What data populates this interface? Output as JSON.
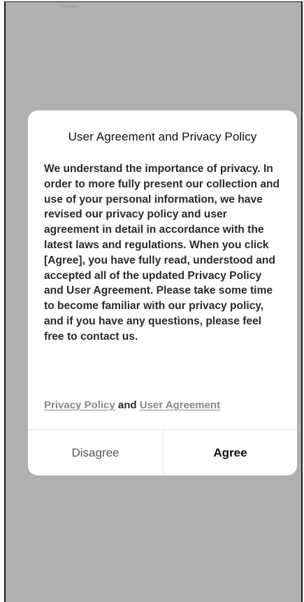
{
  "dialog": {
    "title": "User Agreement and Privacy Policy",
    "body": "We understand the importance of privacy. In order to more fully present our collection and use of your personal information, we have revised our privacy policy and user agreement in detail in accordance with the latest laws and regulations. When you click [Agree], you have fully read, understood and accepted all of the updated Privacy Policy and User Agreement. Please take some time to become familiar with our privacy policy, and if you have any questions, please feel free to contact us.",
    "privacy_link": "Privacy Policy",
    "link_separator": " and ",
    "agreement_link": "User Agreement",
    "disagree_label": "Disagree",
    "agree_label": "Agree"
  },
  "colors": {
    "overlay": "#b0b0b0",
    "dialog_background": "#ffffff",
    "link": "#8a8a8a",
    "divider": "#e6e6e6"
  }
}
